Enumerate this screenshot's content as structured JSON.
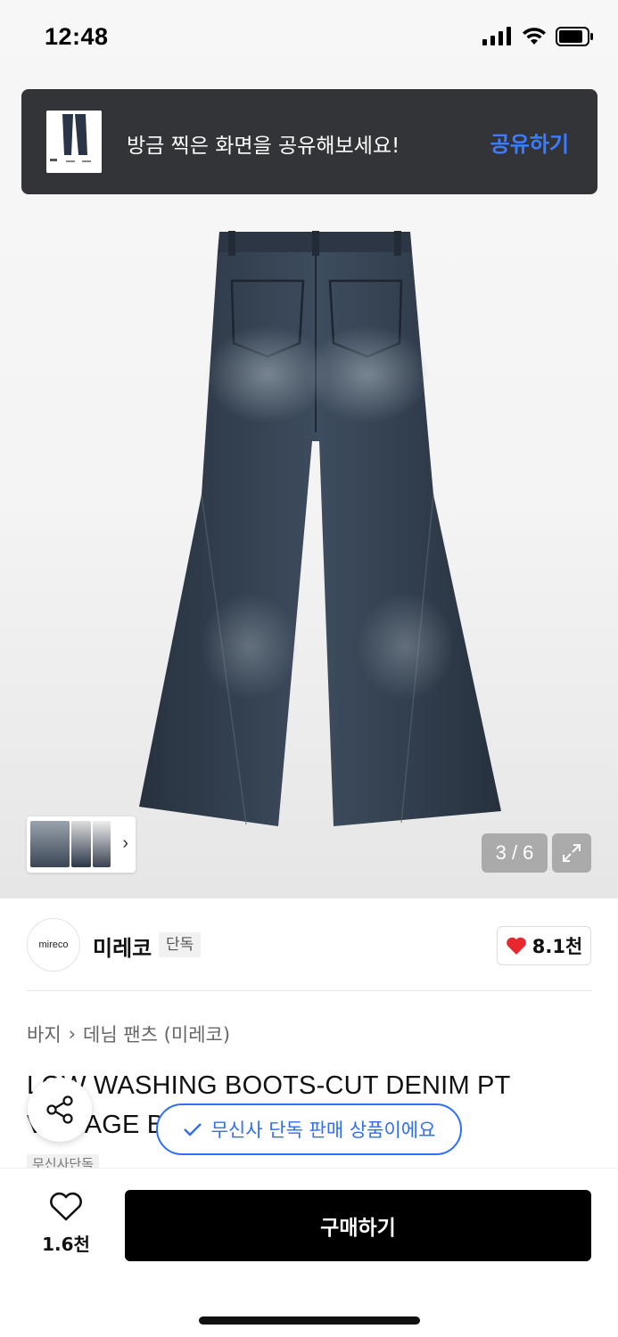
{
  "status": {
    "time": "12:48"
  },
  "share_banner": {
    "message": "방금 찍은 화면을 공유해보세요!",
    "action": "공유하기"
  },
  "gallery": {
    "counter": "3 / 6"
  },
  "brand": {
    "logo_text": "mireco",
    "name": "미레코",
    "badge": "단독",
    "likes": "8.1천"
  },
  "breadcrumb": {
    "category": "바지",
    "separator": "›",
    "subcategory": "데님 팬츠 (미레코)"
  },
  "product": {
    "title": "LOW WASHING BOOTS-CUT DENIM PT VINTAGE BLUE",
    "tag": "무신사단독"
  },
  "toast": {
    "message": "무신사 단독 판매 상품이에요"
  },
  "bottom": {
    "wish_count": "1.6천",
    "buy_label": "구매하기"
  },
  "colors": {
    "accent": "#2f6ef5",
    "heart": "#e8282f",
    "denim": "#2a3547"
  }
}
